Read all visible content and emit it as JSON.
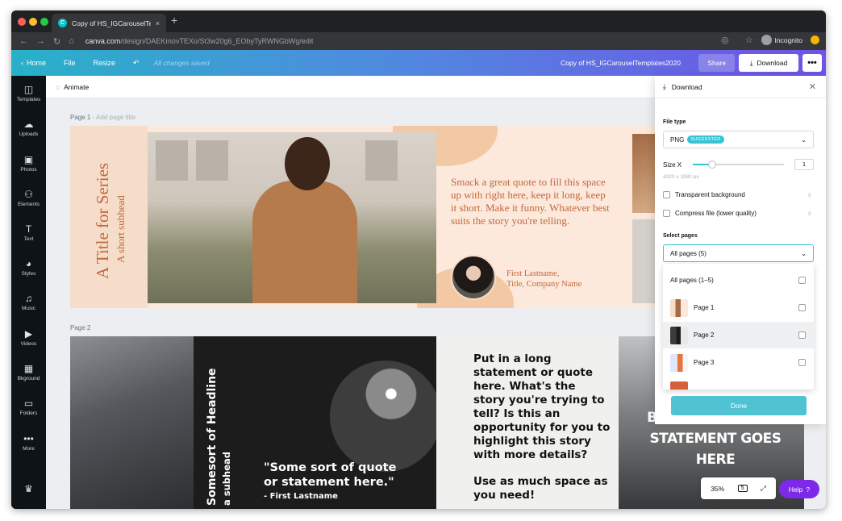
{
  "browser": {
    "tab_title": "Copy of HS_IGCarouselTemplat",
    "tab_close": "×",
    "new_tab": "+",
    "url_host": "canva.com",
    "url_path": "/design/DAEKmovTEXo/St3w20g6_EObyTyRWNGbWg/edit",
    "incognito_label": "Incognito"
  },
  "topbar": {
    "home": "Home",
    "file": "File",
    "resize": "Resize",
    "saved": "All changes saved",
    "doc_title": "Copy of HS_IGCarouselTemplates2020",
    "share": "Share",
    "download": "Download",
    "more": "•••"
  },
  "sidebar": {
    "items": [
      {
        "label": "Templates",
        "icon": "templates-icon",
        "glyph": "◫"
      },
      {
        "label": "Uploads",
        "icon": "upload-cloud-icon",
        "glyph": "☁"
      },
      {
        "label": "Photos",
        "icon": "image-icon",
        "glyph": "▣"
      },
      {
        "label": "Elements",
        "icon": "shapes-icon",
        "glyph": "⚇"
      },
      {
        "label": "Text",
        "icon": "text-icon",
        "glyph": "T"
      },
      {
        "label": "Styles",
        "icon": "palette-icon",
        "glyph": "◕"
      },
      {
        "label": "Music",
        "icon": "music-icon",
        "glyph": "♫"
      },
      {
        "label": "Videos",
        "icon": "video-icon",
        "glyph": "▶"
      },
      {
        "label": "Bkground",
        "icon": "background-icon",
        "glyph": "▦"
      },
      {
        "label": "Folders",
        "icon": "folder-icon",
        "glyph": "▭"
      },
      {
        "label": "More",
        "icon": "more-icon",
        "glyph": "•••"
      }
    ]
  },
  "editor": {
    "animate": "Animate",
    "page1_label": "Page 1",
    "page1_title_placeholder": "- Add page title",
    "page2_label": "Page 2"
  },
  "page1": {
    "title": "A Title for Series",
    "subhead": "A short subhead",
    "quote": "Smack a great quote to fill this space up with right here, keep it long, keep it short. Make it funny. Whatever best suits the story you're telling.",
    "name": "First Lastname,",
    "role": "Title, Company Name"
  },
  "page2": {
    "vertical_title": "Somesort of Headline",
    "vertical_sub": "a subhead",
    "quote_line1": "\"Some sort of quote",
    "quote_line2": "or statement here.\"",
    "quote_author": "- First Lastname",
    "long_statement": "Put in a long statement or quote here. What's the story you're trying to tell? Is this an opportunity for you to highlight this story with more details?",
    "long_statement_2": "Use as much space as you need!",
    "big_line1": "BIG EYE CATCHING",
    "big_line2": "STATEMENT GOES HERE"
  },
  "zoom": {
    "level": "35%",
    "pages_icon": "5"
  },
  "help": {
    "label": "Help",
    "glyph": "?"
  },
  "download_panel": {
    "title": "Download",
    "file_type_label": "File type",
    "file_type": "PNG",
    "suggested_badge": "SUGGESTED",
    "size_label": "Size X",
    "size_value": "1",
    "dimensions": "4320 x 1080 px",
    "transparent_bg": "Transparent background",
    "compress": "Compress file (lower quality)",
    "select_pages_label": "Select pages",
    "select_pages_value": "All pages (5)",
    "options": [
      {
        "label": "All pages (1–5)"
      },
      {
        "label": "Page 1"
      },
      {
        "label": "Page 2"
      },
      {
        "label": "Page 3"
      }
    ],
    "done": "Done"
  },
  "colors": {
    "accent": "#7d2ae8",
    "teal": "#4fc3d1",
    "terracotta": "#c2673c"
  }
}
